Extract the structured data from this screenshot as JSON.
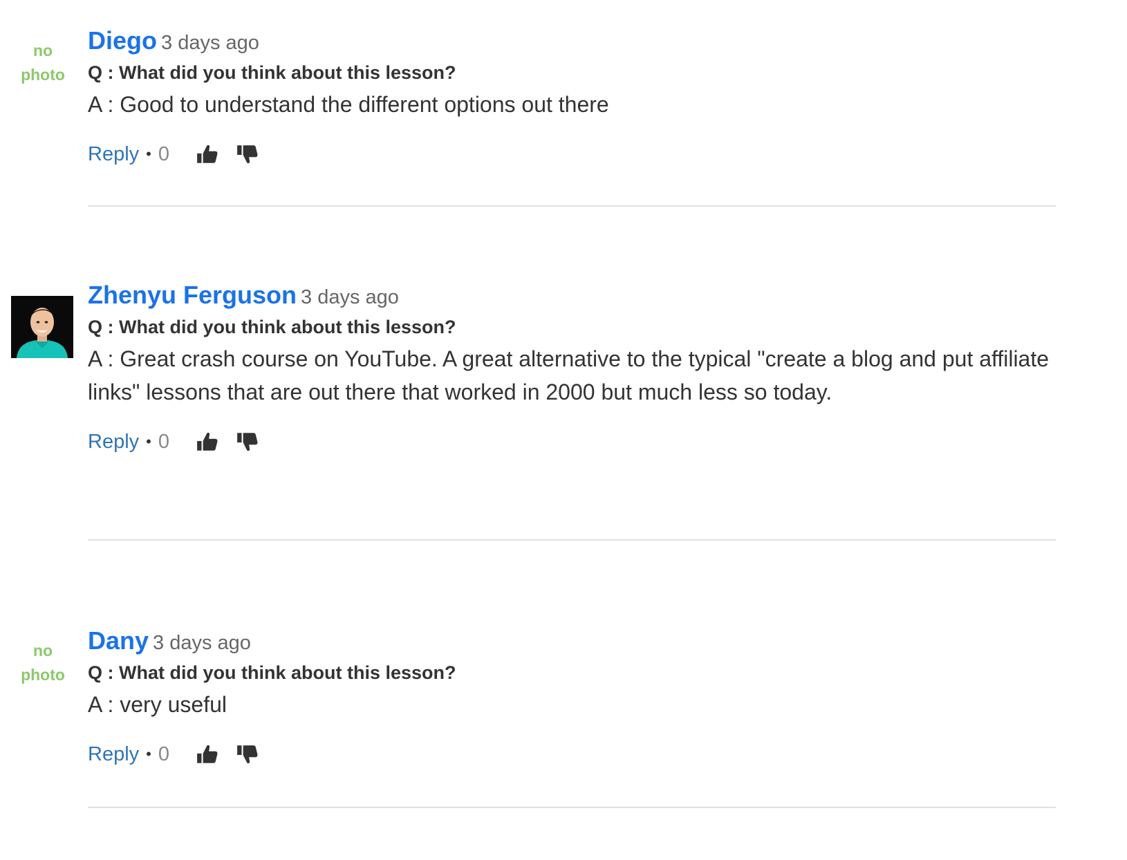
{
  "comments": [
    {
      "author": "Diego",
      "time": "3 days ago",
      "avatar": {
        "type": "none",
        "line1": "no",
        "line2": "photo"
      },
      "question": "Q : What did you think about this lesson?",
      "answer": "A : Good to understand the different options out there",
      "reply_label": "Reply",
      "separator": "•",
      "vote_count": "0"
    },
    {
      "author": "Zhenyu Ferguson",
      "time": "3 days ago",
      "avatar": {
        "type": "photo"
      },
      "question": "Q : What did you think about this lesson?",
      "answer": "A : Great crash course on YouTube. A great alternative to the typical \"create a blog and put affiliate links\" lessons that are out there that worked in 2000 but much less so today.",
      "reply_label": "Reply",
      "separator": "•",
      "vote_count": "0"
    },
    {
      "author": "Dany",
      "time": "3 days ago",
      "avatar": {
        "type": "none",
        "line1": "no",
        "line2": "photo"
      },
      "question": "Q : What did you think about this lesson?",
      "answer": "A : very useful",
      "reply_label": "Reply",
      "separator": "•",
      "vote_count": "0"
    }
  ],
  "icons": {
    "like": "thumbs-up-icon",
    "dislike": "thumbs-down-icon"
  },
  "colors": {
    "author": "#1a73e8",
    "reply": "#2f75b5",
    "no_photo": "#8cc96b",
    "divider": "#e0e0e0",
    "icon": "#333333"
  }
}
